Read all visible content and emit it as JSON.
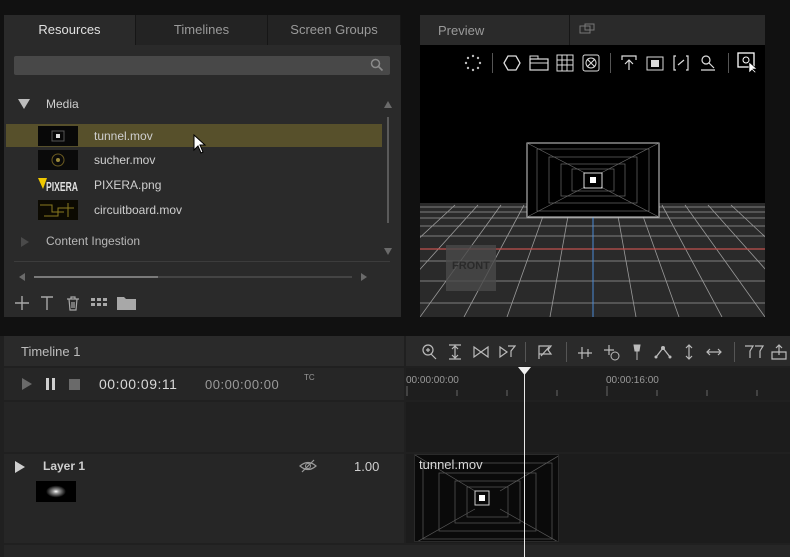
{
  "tabs": [
    "Resources",
    "Timelines",
    "Screen Groups"
  ],
  "preview": {
    "title": "Preview",
    "front_label": "FRONT"
  },
  "search": {
    "placeholder": ""
  },
  "media": {
    "folder": "Media",
    "items": [
      {
        "name": "tunnel.mov",
        "selected": true
      },
      {
        "name": "sucher.mov",
        "selected": false
      },
      {
        "name": "PIXERA.png",
        "selected": false
      },
      {
        "name": "circuitboard.mov",
        "selected": false
      }
    ],
    "other_folder": "Content Ingestion"
  },
  "timeline": {
    "title": "Timeline 1",
    "current_time": "00:00:09:11",
    "secondary_time": "00:00:00:00",
    "tc_label": "TC",
    "ruler": [
      "00:00:00:00",
      "00:00:16:00"
    ]
  },
  "layer": {
    "name": "Layer 1",
    "opacity": "1.00",
    "clip_name": "tunnel.mov"
  },
  "colors": {
    "selected_row": "#57502b",
    "playhead": "#ffffff",
    "accent_blue": "#4a8bd6",
    "front_line": "#c0504d"
  }
}
